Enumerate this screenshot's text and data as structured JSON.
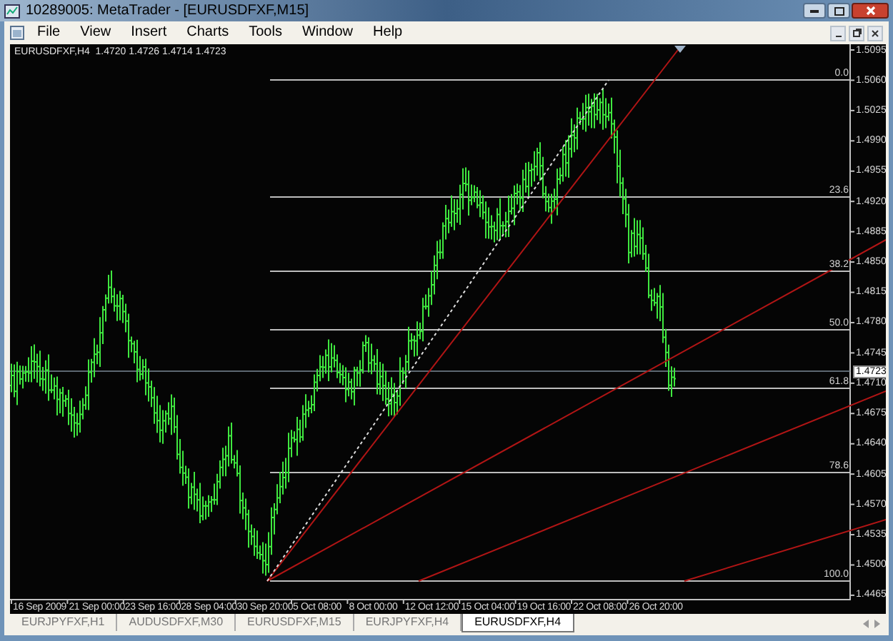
{
  "window": {
    "title": "10289005: MetaTrader - [EURUSDFXF,M15]"
  },
  "menu": [
    "File",
    "View",
    "Insert",
    "Charts",
    "Tools",
    "Window",
    "Help"
  ],
  "chart": {
    "header": "EURUSDFXF,H4  1.4720 1.4726 1.4714 1.4723",
    "price_axis": [
      "1.5095",
      "1.5060",
      "1.5025",
      "1.4990",
      "1.4955",
      "1.4920",
      "1.4885",
      "1.4850",
      "1.4815",
      "1.4780",
      "1.4745",
      "1.4710",
      "1.4675",
      "1.4640",
      "1.4605",
      "1.4570",
      "1.4535",
      "1.4500",
      "1.4465"
    ],
    "current_price": "1.4723",
    "fibo_levels": [
      "0.0",
      "23.6",
      "38.2",
      "50.0",
      "61.8",
      "78.6",
      "100.0"
    ],
    "time_axis": [
      "16 Sep 2009",
      "21 Sep 00:00",
      "23 Sep 16:00",
      "28 Sep 04:00",
      "30 Sep 20:00",
      "5 Oct 08:00",
      "8 Oct 00:00",
      "12 Oct 12:00",
      "15 Oct 04:00",
      "19 Oct 16:00",
      "22 Oct 08:00",
      "26 Oct 20:00"
    ]
  },
  "tabs": [
    {
      "label": "EURJPYFXF,H1",
      "selected": false
    },
    {
      "label": "AUDUSDFXF,M30",
      "selected": false
    },
    {
      "label": "EURUSDFXF,M15",
      "selected": false
    },
    {
      "label": "EURJPYFXF,H4",
      "selected": false
    },
    {
      "label": "EURUSDFXF,H4",
      "selected": true
    }
  ]
}
